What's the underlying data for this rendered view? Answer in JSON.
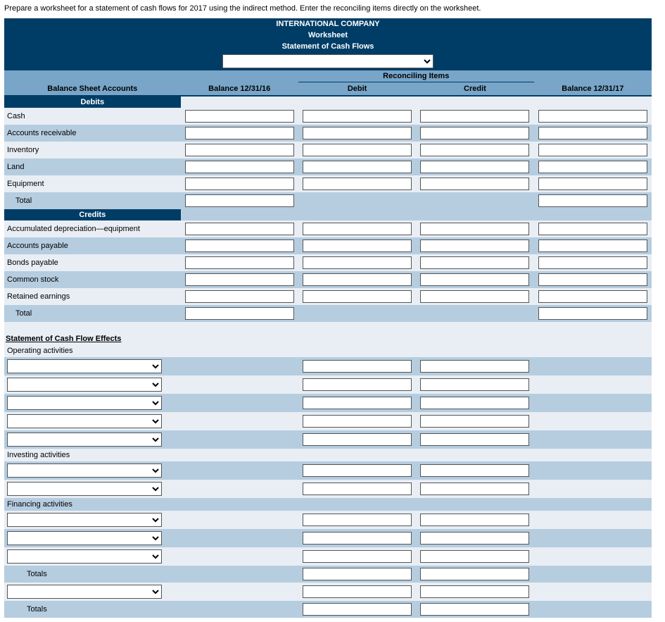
{
  "instructions": "Prepare a worksheet for a statement of cash flows for 2017 using the indirect method. Enter the reconciling items directly on the worksheet.",
  "header": {
    "company": "INTERNATIONAL COMPANY",
    "title": "Worksheet",
    "subtitle": "Statement of Cash Flows"
  },
  "columns": {
    "accounts": "Balance Sheet Accounts",
    "bal_begin": "Balance 12/31/16",
    "recon_group": "Reconciling Items",
    "debit": "Debit",
    "credit": "Credit",
    "bal_end": "Balance 12/31/17"
  },
  "sections": {
    "debits": "Debits",
    "credits": "Credits",
    "total": "Total",
    "totals": "Totals",
    "cf_effects": "Statement of Cash Flow Effects",
    "operating": "Operating activities",
    "investing": "Investing activities",
    "financing": "Financing activities"
  },
  "debit_accounts": [
    {
      "label": "Cash"
    },
    {
      "label": "Accounts receivable"
    },
    {
      "label": "Inventory"
    },
    {
      "label": "Land"
    },
    {
      "label": "Equipment"
    }
  ],
  "credit_accounts": [
    {
      "label": "Accumulated depreciation—equipment"
    },
    {
      "label": "Accounts payable"
    },
    {
      "label": "Bonds payable"
    },
    {
      "label": "Common stock"
    },
    {
      "label": "Retained earnings"
    }
  ]
}
